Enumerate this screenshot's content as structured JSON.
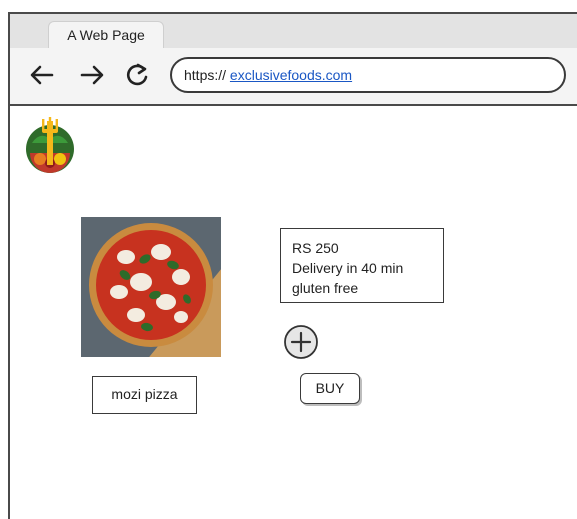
{
  "browser": {
    "tab_title": "A Web Page",
    "url_scheme": "https://",
    "url_domain": "exclusivefoods.com",
    "icons": {
      "back": "arrow-left-icon",
      "forward": "arrow-right-icon",
      "reload": "reload-icon"
    }
  },
  "page": {
    "logo": "food-logo",
    "product": {
      "name": "mozi pizza",
      "price": "RS 250",
      "delivery": "Delivery in 40 min",
      "diet": "gluten free",
      "add_icon": "plus-circle-icon",
      "buy_label": "BUY"
    }
  }
}
